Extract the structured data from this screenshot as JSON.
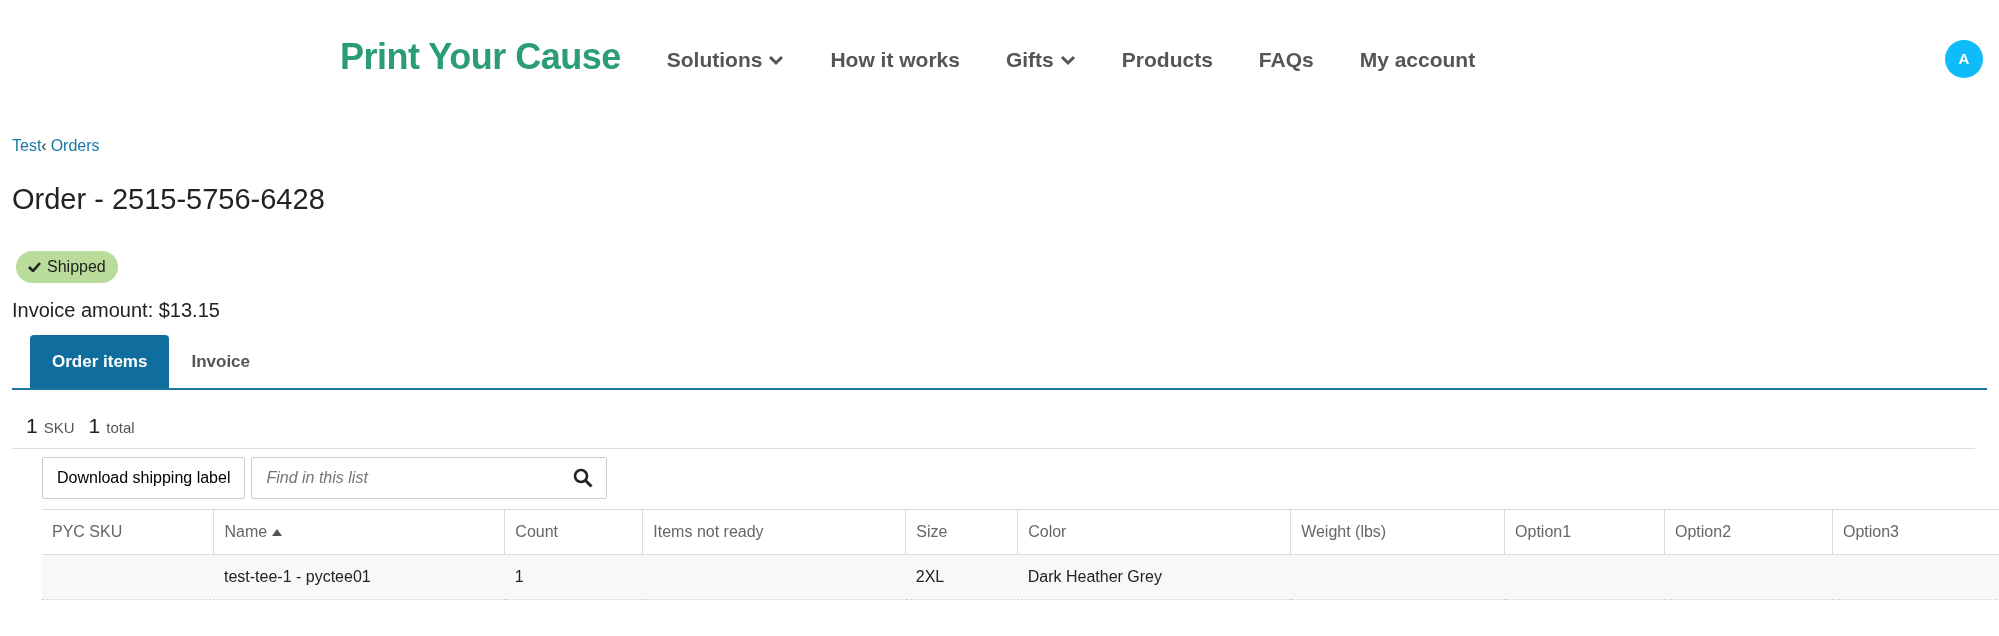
{
  "header": {
    "logo": "Print Your Cause",
    "nav": [
      {
        "label": "Solutions",
        "dropdown": true
      },
      {
        "label": "How it works",
        "dropdown": false
      },
      {
        "label": "Gifts",
        "dropdown": true
      },
      {
        "label": "Products",
        "dropdown": false
      },
      {
        "label": "FAQs",
        "dropdown": false
      },
      {
        "label": "My account",
        "dropdown": false
      }
    ],
    "avatar": "A"
  },
  "breadcrumb": {
    "parent": "Test",
    "separator": "‹",
    "current": "Orders"
  },
  "title": "Order - 2515-5756-6428",
  "status": "Shipped",
  "invoice_amount": "Invoice amount: $13.15",
  "tabs": [
    {
      "label": "Order items",
      "selected": true
    },
    {
      "label": "Invoice",
      "selected": false
    }
  ],
  "summary": {
    "sku_count": "1",
    "sku_label": "SKU",
    "total_count": "1",
    "total_label": "total"
  },
  "toolbar": {
    "button": "Download shipping label",
    "search": {
      "placeholder": "Find in this list"
    }
  },
  "table": {
    "columns": [
      {
        "label": "PYC SKU",
        "sorted": false
      },
      {
        "label": "Name",
        "sorted": true
      },
      {
        "label": "Count",
        "sorted": false
      },
      {
        "label": "Items not ready",
        "sorted": false
      },
      {
        "label": "Size",
        "sorted": false
      },
      {
        "label": "Color",
        "sorted": false
      },
      {
        "label": "Weight (lbs)",
        "sorted": false
      },
      {
        "label": "Option1",
        "sorted": false
      },
      {
        "label": "Option2",
        "sorted": false
      },
      {
        "label": "Option3",
        "sorted": false
      }
    ],
    "rows": [
      [
        "",
        "test-tee-1 - pyctee01",
        "1",
        "",
        "2XL",
        "Dark Heather Grey",
        "",
        "",
        "",
        ""
      ]
    ]
  }
}
